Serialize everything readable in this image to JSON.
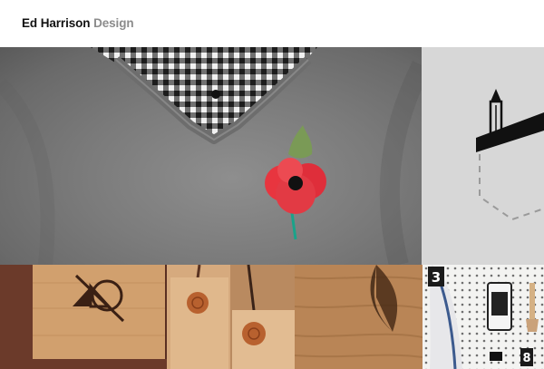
{
  "site": {
    "logo_name": "Ed Harrison",
    "logo_suffix": "Design"
  },
  "portfolio": {
    "tiles": [
      {
        "name": "poppy-sweater-project"
      },
      {
        "name": "pocket-pen-illustration-project"
      },
      {
        "name": "wood-coaster-project"
      },
      {
        "name": "wood-tags-project"
      },
      {
        "name": "wood-board-project"
      },
      {
        "name": "pegboard-project"
      }
    ],
    "pegboard_numbers": [
      "3",
      "8"
    ]
  }
}
